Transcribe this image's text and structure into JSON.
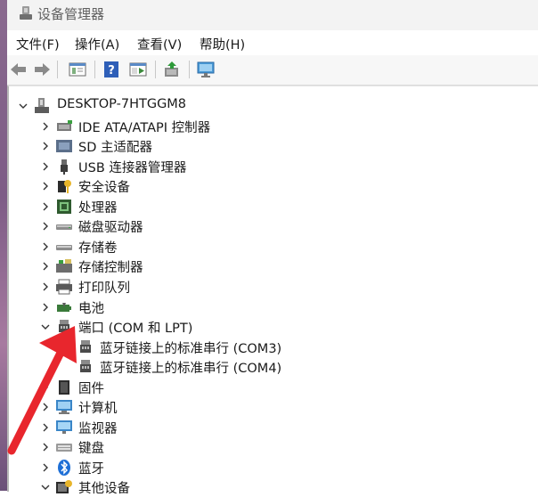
{
  "window": {
    "title": "设备管理器"
  },
  "menu": [
    "文件(F)",
    "操作(A)",
    "查看(V)",
    "帮助(H)"
  ],
  "toolbar": {
    "buttons": [
      "back-icon",
      "forward-icon",
      "properties-icon",
      "help-icon",
      "show-hide-tree-icon",
      "update-driver-icon",
      "scan-hardware-icon"
    ]
  },
  "tree": {
    "root": "DESKTOP-7HTGGM8",
    "categories": [
      {
        "label": "IDE ATA/ATAPI 控制器",
        "icon": "ide-controller-icon",
        "expanded": false
      },
      {
        "label": "SD 主适配器",
        "icon": "sd-adapter-icon",
        "expanded": false
      },
      {
        "label": "USB 连接器管理器",
        "icon": "usb-connector-icon",
        "expanded": false
      },
      {
        "label": "安全设备",
        "icon": "security-key-icon",
        "expanded": false
      },
      {
        "label": "处理器",
        "icon": "processor-icon",
        "expanded": false
      },
      {
        "label": "磁盘驱动器",
        "icon": "disk-drive-icon",
        "expanded": false
      },
      {
        "label": "存储卷",
        "icon": "storage-volume-icon",
        "expanded": false
      },
      {
        "label": "存储控制器",
        "icon": "storage-controller-icon",
        "expanded": false
      },
      {
        "label": "打印队列",
        "icon": "printer-icon",
        "expanded": false
      },
      {
        "label": "电池",
        "icon": "battery-icon",
        "expanded": false
      },
      {
        "label": "端口 (COM 和 LPT)",
        "icon": "port-icon",
        "expanded": true,
        "children": [
          "蓝牙链接上的标准串行 (COM3)",
          "蓝牙链接上的标准串行 (COM4)"
        ]
      },
      {
        "label": "固件",
        "icon": "firmware-icon",
        "expanded": false
      },
      {
        "label": "计算机",
        "icon": "computer-icon",
        "expanded": false
      },
      {
        "label": "监视器",
        "icon": "monitor-icon",
        "expanded": false
      },
      {
        "label": "键盘",
        "icon": "keyboard-icon",
        "expanded": false
      },
      {
        "label": "蓝牙",
        "icon": "bluetooth-icon",
        "expanded": false
      },
      {
        "label": "其他设备",
        "icon": "other-devices-icon",
        "expanded": true
      }
    ]
  },
  "annotation": {
    "arrow_color": "#e8262d"
  }
}
